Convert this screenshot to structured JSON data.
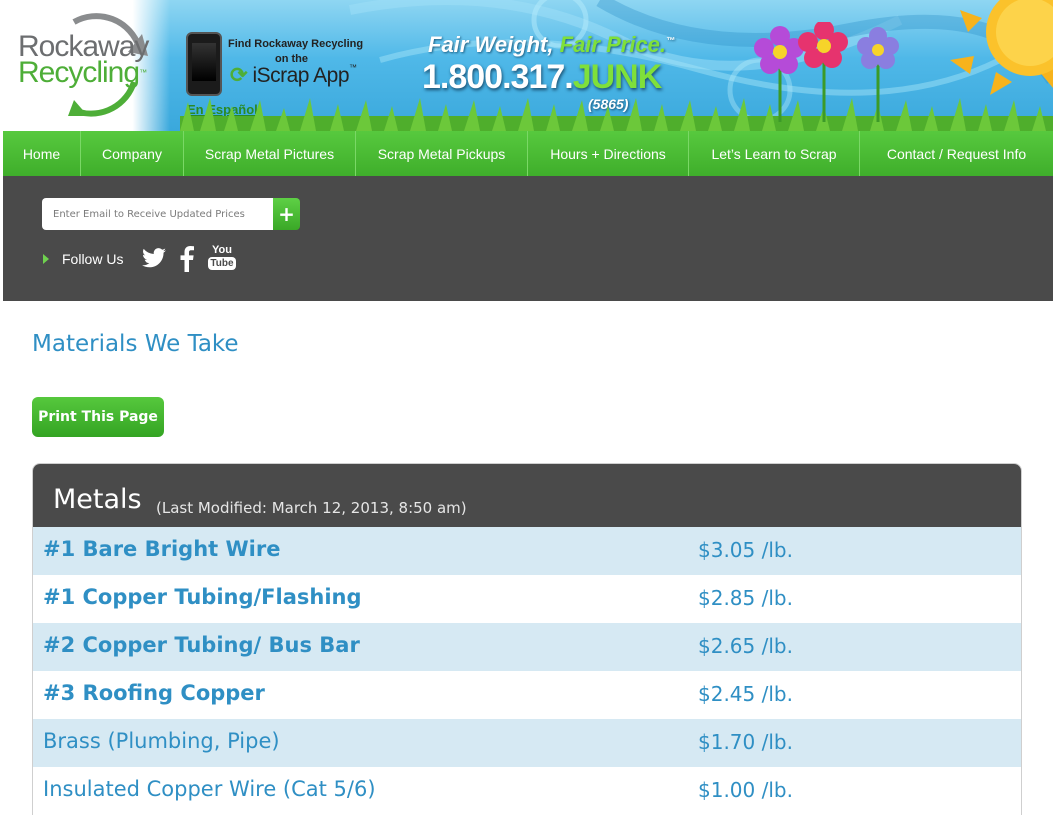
{
  "header": {
    "logo_line1": "Rockaway",
    "logo_line2": "Recycling",
    "logo_tm": "™",
    "app_find": "Find Rockaway Recycling",
    "app_onthe": "on the",
    "app_name": "iScrap App",
    "app_tm": "™",
    "espanol": "En Español!",
    "slogan_white": "Fair Weight,",
    "slogan_green": "Fair Price.",
    "slogan_tm": "™",
    "phone_white": "1.800.317.",
    "phone_green": "JUNK",
    "phone_sub": "(5865)",
    "colors": {
      "sky": "#4fb8e8",
      "green": "#7fe03a",
      "logo_green": "#4eae38"
    }
  },
  "nav": {
    "items": [
      {
        "label": "Home"
      },
      {
        "label": "Company"
      },
      {
        "label": "Scrap Metal Pictures"
      },
      {
        "label": "Scrap Metal Pickups"
      },
      {
        "label": "Hours + Directions"
      },
      {
        "label": "Let’s Learn to Scrap"
      },
      {
        "label": "Contact / Request Info"
      }
    ],
    "color": "#46b52f"
  },
  "subscribe": {
    "placeholder": "Enter Email to Receive Updated Prices",
    "button_label": "+",
    "follow_label": "Follow Us",
    "youtube_you": "You",
    "youtube_tube": "Tube",
    "icons": [
      "twitter-icon",
      "facebook-icon",
      "youtube-icon"
    ]
  },
  "main": {
    "title": "Materials We Take",
    "print_label": "Print This Page",
    "metals": {
      "title": "Metals",
      "modified": "(Last Modified: March 12, 2013, 8:50 am)",
      "rows": [
        {
          "name": "#1 Bare Bright Wire",
          "price": "$3.05 /lb.",
          "bold": true
        },
        {
          "name": "#1 Copper Tubing/Flashing",
          "price": "$2.85 /lb.",
          "bold": true
        },
        {
          "name": "#2 Copper Tubing/ Bus Bar",
          "price": "$2.65 /lb.",
          "bold": true
        },
        {
          "name": "#3 Roofing Copper",
          "price": "$2.45 /lb.",
          "bold": true
        },
        {
          "name": "Brass (Plumbing, Pipe)",
          "price": "$1.70 /lb.",
          "bold": false
        },
        {
          "name": "Insulated Copper Wire (Cat 5/6)",
          "price": "$1.00 /lb.",
          "bold": false
        }
      ]
    },
    "text_color": "#2f8fc4"
  }
}
